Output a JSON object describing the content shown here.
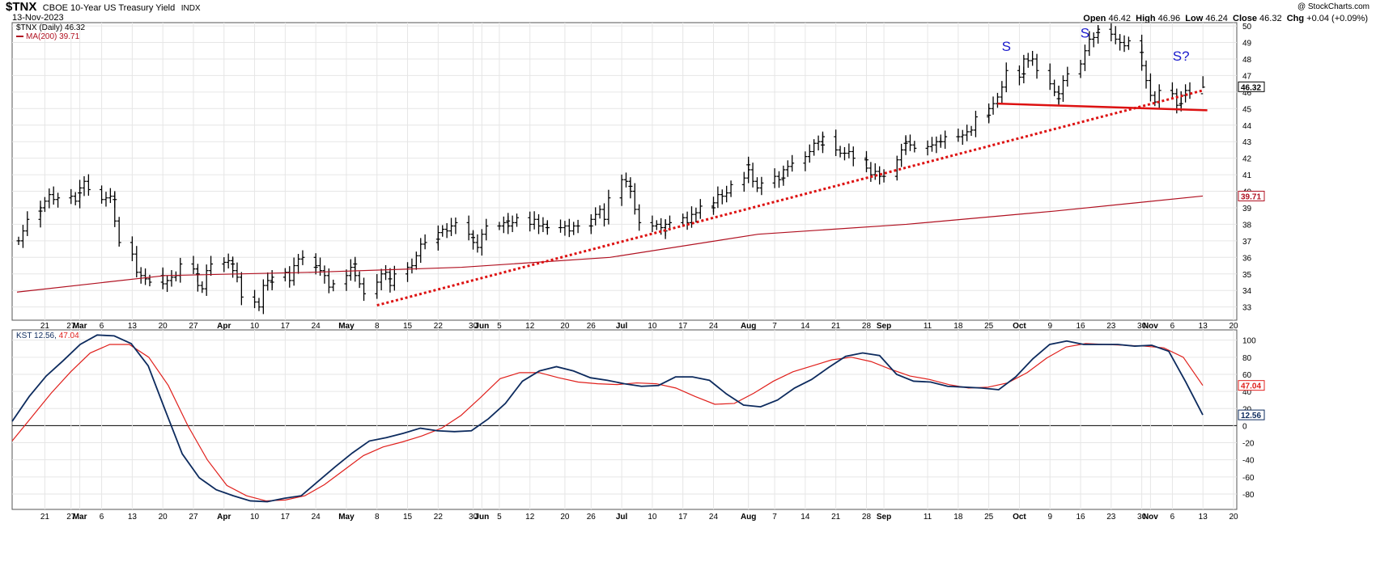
{
  "header": {
    "symbol": "$TNX",
    "name": "CBOE 10-Year US Treasury Yield",
    "exchange": "INDX",
    "date": "13-Nov-2023",
    "copyright": "@ StockCharts.com",
    "ohlc": [
      {
        "label": "Open",
        "value": "46.42"
      },
      {
        "label": "High",
        "value": "46.96"
      },
      {
        "label": "Low",
        "value": "46.24"
      },
      {
        "label": "Close",
        "value": "46.32"
      },
      {
        "label": "Chg",
        "value": "+0.04 (+0.09%)"
      }
    ]
  },
  "colors": {
    "price_bars": "#000000",
    "ma": "#b01020",
    "kst_line": "#0d2b5e",
    "kst_signal": "#e0201c",
    "trendline": "#dd1111",
    "annotation": "#1a1acc",
    "grid": "#e6e6e6"
  },
  "chart_data": [
    {
      "type": "ohlc",
      "panel": "price",
      "title": "$TNX (Daily) 46.32",
      "last_price_label": "46.32",
      "y_axis_ticks": [
        33,
        34,
        35,
        36,
        37,
        38,
        39,
        40,
        41,
        42,
        43,
        44,
        45,
        46,
        47,
        48,
        49,
        50
      ],
      "ylim": [
        32.2,
        50.2
      ],
      "grid": true,
      "x_axis_labels": [
        "21",
        "27",
        "Mar",
        "6",
        "13",
        "20",
        "27",
        "Apr",
        "10",
        "17",
        "24",
        "May",
        "8",
        "15",
        "22",
        "30",
        "Jun",
        "5",
        "12",
        "20",
        "26",
        "Jul",
        "10",
        "17",
        "24",
        "Aug",
        "7",
        "14",
        "21",
        "28",
        "Sep",
        "11",
        "18",
        "25",
        "Oct",
        "9",
        "16",
        "23",
        "30",
        "Nov",
        "6",
        "13",
        "20"
      ],
      "series": [
        {
          "name": "$TNX (Daily)",
          "closes": [
            37.0,
            37.6,
            38.3,
            38.8,
            39.0,
            39.4,
            39.8,
            39.5,
            39.6,
            39.7,
            39.4,
            39.9,
            40.2,
            40.6,
            40.1,
            39.5,
            39.6,
            39.7,
            39.5,
            38.2,
            36.9,
            36.2,
            35.1,
            34.9,
            34.7,
            34.5,
            34.9,
            34.4,
            34.6,
            34.8,
            34.9,
            35.6,
            35.3,
            35.0,
            34.3,
            34.1,
            35.2,
            35.6,
            35.7,
            35.8,
            35.6,
            35.2,
            34.8,
            33.6,
            33.3,
            33.0,
            34.3,
            34.6,
            34.5,
            34.8,
            35.1,
            34.6,
            35.5,
            35.9,
            36.0,
            35.4,
            35.5,
            35.2,
            34.9,
            34.2,
            34.4,
            34.9,
            35.4,
            35.6,
            34.9,
            34.4,
            33.8,
            34.5,
            35.0,
            35.1,
            34.7,
            34.3,
            35.0,
            35.4,
            35.5,
            36.1,
            36.8,
            36.9,
            37.1,
            37.5,
            37.7,
            37.6,
            37.9,
            38.1,
            37.4,
            37.2,
            36.9,
            36.6,
            37.4,
            37.9,
            37.9,
            38.1,
            38.2,
            37.9,
            38.1,
            38.4,
            38.0,
            38.3,
            37.9,
            38.0,
            37.8,
            37.8,
            37.8,
            37.9,
            37.6,
            37.9,
            37.9,
            37.9,
            38.3,
            38.6,
            38.9,
            38.3,
            39.6,
            40.7,
            40.6,
            40.3,
            40.0,
            38.9,
            38.1,
            37.9,
            38.0,
            37.8,
            37.6,
            38.0,
            38.1,
            38.4,
            38.1,
            38.6,
            38.7,
            39.1,
            39.0,
            39.3,
            39.8,
            39.7,
            39.9,
            40.4,
            40.8,
            41.6,
            41.3,
            40.6,
            40.2,
            40.5,
            40.9,
            40.7,
            40.8,
            41.3,
            41.5,
            41.7,
            42.1,
            42.4,
            42.9,
            43.0,
            42.8,
            43.3,
            42.5,
            42.3,
            42.3,
            42.4,
            42.0,
            41.9,
            41.4,
            41.0,
            41.2,
            40.9,
            40.9,
            41.9,
            42.5,
            42.9,
            43.0,
            42.8,
            42.6,
            42.7,
            42.8,
            43.0,
            43.0,
            43.0,
            43.3,
            43.3,
            43.4,
            43.6,
            43.7,
            44.5,
            44.6,
            45.0,
            45.3,
            45.7,
            46.3,
            47.3,
            46.9,
            47.1,
            48.0,
            47.9,
            48.0,
            47.3,
            46.5,
            46.0,
            45.6,
            45.9,
            46.7,
            47.1,
            47.7,
            48.5,
            49.2,
            49.3,
            49.6,
            49.8,
            49.5,
            49.2,
            49.0,
            48.8,
            49.1,
            48.4,
            47.6,
            46.7,
            45.8,
            45.4,
            46.1,
            45.9,
            45.2,
            45.3,
            45.8,
            46.1,
            45.9,
            46.3
          ]
        },
        {
          "name": "MA(200) 39.71",
          "values": [
            33.9,
            34.9,
            35.1,
            35.4,
            36.0,
            37.4,
            38.0,
            38.8,
            39.71
          ]
        }
      ],
      "annotations": [
        {
          "text": "S",
          "date": "2023-09-29",
          "y": 48.5
        },
        {
          "text": "S",
          "date": "2023-10-17",
          "y": 49.3
        },
        {
          "text": "S?",
          "date": "2023-11-08",
          "y": 47.9
        }
      ],
      "trendlines": [
        {
          "style": "dotted",
          "from": {
            "date": "2023-05-08",
            "y": 33.1
          },
          "to": {
            "date": "2023-11-13",
            "y": 46.1
          }
        },
        {
          "style": "solid",
          "from": {
            "date": "2023-09-27",
            "y": 45.3
          },
          "to": {
            "date": "2023-11-14",
            "y": 44.9
          }
        }
      ]
    },
    {
      "type": "line",
      "panel": "indicator",
      "title": "KST 12.56, 47.04",
      "y_axis_ticks": [
        -80,
        -60,
        -40,
        -20,
        0,
        20,
        40,
        60,
        80,
        100
      ],
      "ylim": [
        -98,
        112
      ],
      "grid": true,
      "x_axis_labels": [
        "21",
        "27",
        "Mar",
        "6",
        "13",
        "20",
        "27",
        "Apr",
        "10",
        "17",
        "24",
        "May",
        "8",
        "15",
        "22",
        "30",
        "Jun",
        "5",
        "12",
        "20",
        "26",
        "Jul",
        "10",
        "17",
        "24",
        "Aug",
        "7",
        "14",
        "21",
        "28",
        "Sep",
        "11",
        "18",
        "25",
        "Oct",
        "9",
        "16",
        "23",
        "30",
        "Nov",
        "6",
        "13",
        "20"
      ],
      "series": [
        {
          "name": "KST",
          "value_label": "12.56",
          "values": [
            5,
            34,
            58,
            76,
            95,
            106,
            105,
            96,
            70,
            18,
            -33,
            -61,
            -75,
            -82,
            -88,
            -89,
            -85,
            -82,
            -65,
            -48,
            -32,
            -18,
            -14,
            -9,
            -3,
            -6,
            -7,
            -6,
            8,
            26,
            52,
            64,
            69,
            64,
            56,
            53,
            49,
            46,
            47,
            57,
            57,
            53,
            37,
            24,
            22,
            30,
            44,
            54,
            68,
            81,
            85,
            82,
            60,
            52,
            51,
            46,
            45,
            44,
            42,
            57,
            78,
            95,
            99,
            95,
            95,
            95,
            93,
            94,
            87,
            51,
            12.56
          ]
        },
        {
          "name": "KST signal",
          "value_label": "47.04",
          "values": [
            -18,
            10,
            38,
            63,
            85,
            95,
            95,
            80,
            47,
            0,
            -40,
            -70,
            -82,
            -88,
            -87,
            -82,
            -69,
            -52,
            -35,
            -25,
            -19,
            -12,
            -3,
            12,
            33,
            55,
            62,
            62,
            56,
            51,
            49,
            48,
            50,
            49,
            44,
            34,
            25,
            26,
            38,
            52,
            63,
            70,
            77,
            80,
            75,
            66,
            58,
            54,
            48,
            44,
            45,
            50,
            62,
            79,
            92,
            96,
            95,
            94,
            93,
            91,
            80,
            47.04
          ]
        }
      ]
    }
  ]
}
